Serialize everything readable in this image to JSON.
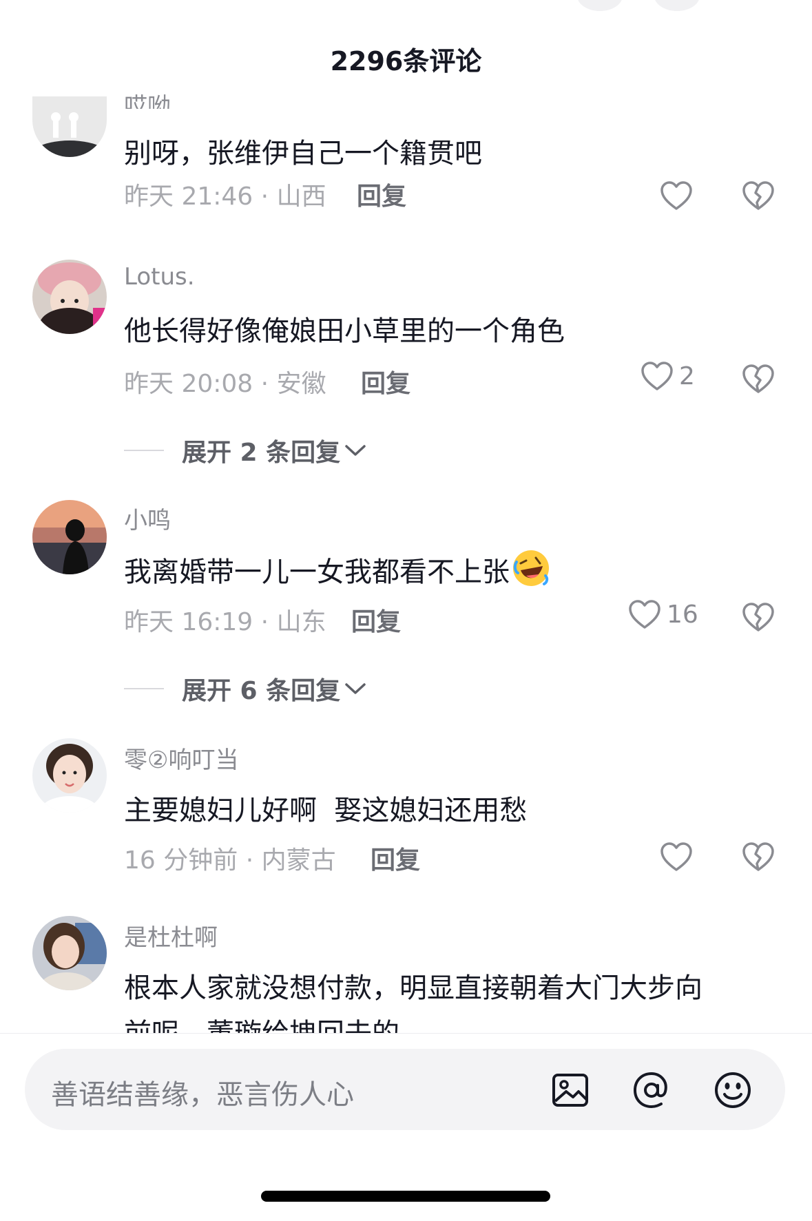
{
  "header": {
    "title": "2296条评论"
  },
  "comments": [
    {
      "username": "哎呦",
      "text": "别呀，张维伊自己一个籍贯吧",
      "time": "昨天 21:46",
      "location": "山西",
      "reply_label": "回复",
      "likes": ""
    },
    {
      "username": "Lotus.",
      "text": "他长得好像俺娘田小草里的一个角色",
      "time": "昨天 20:08",
      "location": "安徽",
      "reply_label": "回复",
      "likes": "2",
      "expand_label": "展开 2 条回复"
    },
    {
      "username": "小鸣",
      "text": "我离婚带一儿一女我都看不上张",
      "emoji": "rolling-on-floor-laughing-emoji",
      "time": "昨天 16:19",
      "location": "山东",
      "reply_label": "回复",
      "likes": "16",
      "expand_label": "展开 6 条回复"
    },
    {
      "username": "零②响叮当",
      "text": "主要媳妇儿好啊  娶这媳妇还用愁",
      "time": "16 分钟前",
      "location": "内蒙古",
      "reply_label": "回复",
      "likes": ""
    },
    {
      "username": "是杜杜啊",
      "text": "根本人家就没想付款，明显直接朝着大门大步向",
      "text_line2": "前呢，董璇给拽回去的",
      "likes": ""
    }
  ],
  "input": {
    "placeholder": "善语结善缘，恶言伤人心"
  },
  "icons": {
    "like": "heart-icon",
    "dislike": "broken-heart-icon",
    "expand": "chevron-down-icon",
    "image": "image-icon",
    "mention": "at-icon",
    "emoji": "smiley-icon"
  },
  "colors": {
    "primary_text": "#161823",
    "secondary_text": "#a8a9ae",
    "icon_gray": "#8a8b91"
  }
}
